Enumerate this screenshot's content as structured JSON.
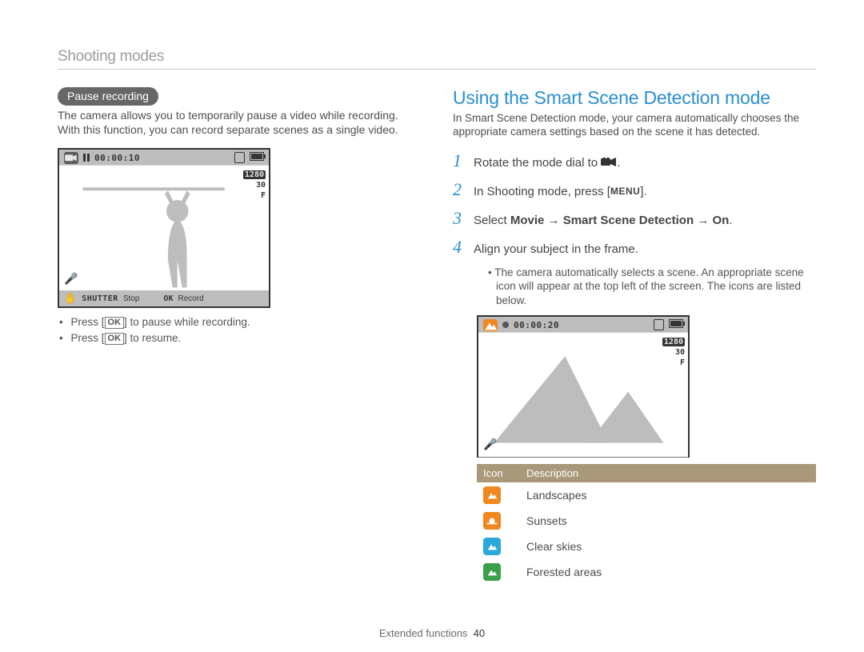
{
  "header": "Shooting modes",
  "left": {
    "pill": "Pause recording",
    "paragraph": "The camera allows you to temporarily pause a video while recording. With this function, you can record separate scenes as a single video.",
    "screen": {
      "timer": "00:00:10",
      "res": "1280",
      "fps": "30",
      "rate": "F",
      "stop_label": "Stop",
      "record_label": "Record",
      "shutter_label": "SHUTTER",
      "ok_label": "OK"
    },
    "bullets": [
      {
        "pre": "Press [",
        "mid": "OK",
        "post": "] to pause while recording."
      },
      {
        "pre": "Press [",
        "mid": "OK",
        "post": "] to resume."
      }
    ]
  },
  "right": {
    "title": "Using the Smart Scene Detection mode",
    "intro": "In Smart Scene Detection mode, your camera automatically chooses the appropriate camera settings based on the scene it has detected.",
    "steps": {
      "s1": "Rotate the mode dial to ",
      "s2_a": "In Shooting mode, press [",
      "s2_menu": "MENU",
      "s2_b": "].",
      "s3_a": "Select ",
      "s3_b1": "Movie",
      "s3_arrow": " → ",
      "s3_b2": "Smart Scene Detection",
      "s3_b3": "On",
      "s3_c": ".",
      "s4": "Align your subject in the frame.",
      "s4_note": "The camera automatically selects a scene. An appropriate scene icon will appear at the top left of the screen. The icons are listed below."
    },
    "screen": {
      "timer": "00:00:20",
      "res": "1280",
      "fps": "30",
      "rate": "F"
    },
    "table": {
      "col_icon": "Icon",
      "col_desc": "Description",
      "rows": [
        {
          "color": "#f0881f",
          "shape": "mountain",
          "label": "Landscapes"
        },
        {
          "color": "#f0881f",
          "shape": "sunset",
          "label": "Sunsets"
        },
        {
          "color": "#2aa8d8",
          "shape": "mountain",
          "label": "Clear skies"
        },
        {
          "color": "#3aa04a",
          "shape": "mountain",
          "label": "Forested areas"
        }
      ]
    }
  },
  "footer": {
    "section": "Extended functions",
    "page": "40"
  }
}
